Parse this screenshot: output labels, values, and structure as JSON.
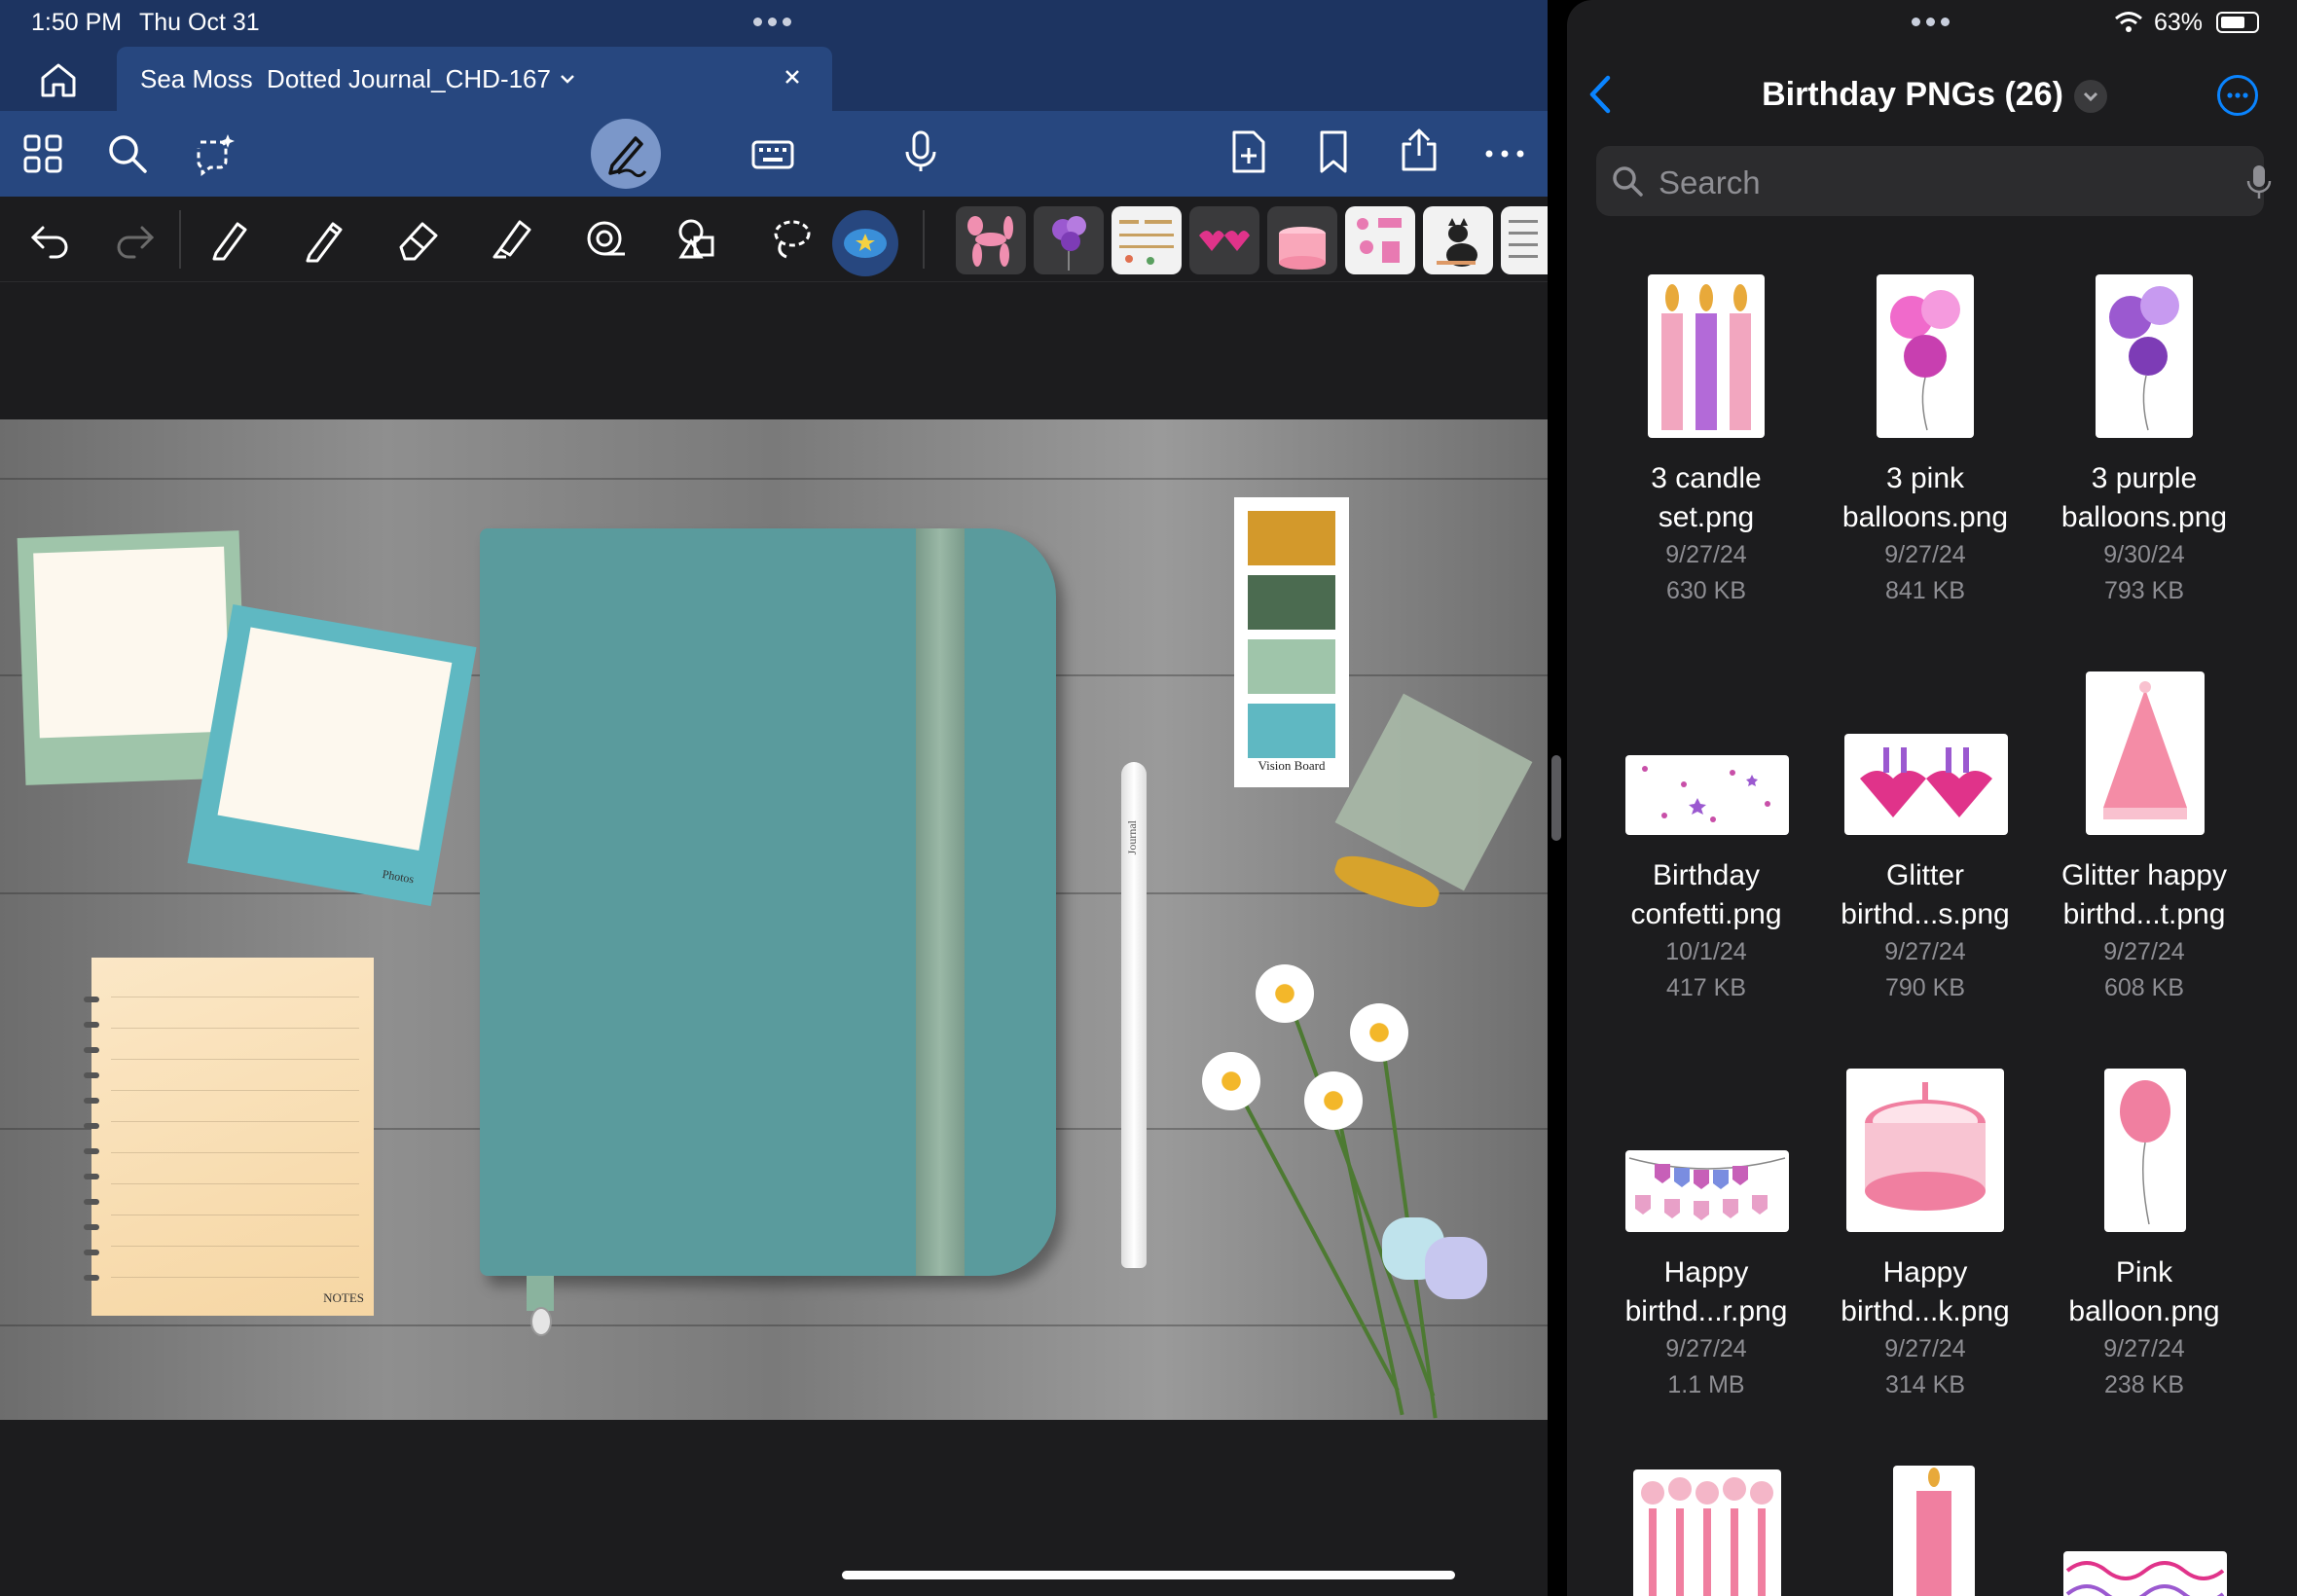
{
  "status": {
    "time": "1:50 PM",
    "date": "Thu Oct 31",
    "battery": "63%"
  },
  "document": {
    "tab_title": "Sea Moss  Dotted Journal_CHD-167"
  },
  "canvas_labels": {
    "photos": "Photos",
    "notes": "NOTES",
    "vision_board": "Vision Board",
    "pencil": "Journal"
  },
  "swatch_colors": [
    "#d3992b",
    "#4b6b50",
    "#9fc5aa",
    "#5fb8c2"
  ],
  "files_app": {
    "folder_title": "Birthday PNGs (26)",
    "search_placeholder": "Search",
    "files": [
      {
        "name_line1": "3 candle",
        "name_line2": "set.png",
        "date": "9/27/24",
        "size": "630 KB"
      },
      {
        "name_line1": "3 pink",
        "name_line2": "balloons.png",
        "date": "9/27/24",
        "size": "841 KB"
      },
      {
        "name_line1": "3 purple",
        "name_line2": "balloons.png",
        "date": "9/30/24",
        "size": "793 KB"
      },
      {
        "name_line1": "Birthday",
        "name_line2": "confetti.png",
        "date": "10/1/24",
        "size": "417 KB"
      },
      {
        "name_line1": "Glitter",
        "name_line2": "birthd...s.png",
        "date": "9/27/24",
        "size": "790 KB"
      },
      {
        "name_line1": "Glitter happy",
        "name_line2": "birthd...t.png",
        "date": "9/27/24",
        "size": "608 KB"
      },
      {
        "name_line1": "Happy",
        "name_line2": "birthd...r.png",
        "date": "9/27/24",
        "size": "1.1 MB"
      },
      {
        "name_line1": "Happy",
        "name_line2": "birthd...k.png",
        "date": "9/27/24",
        "size": "314 KB"
      },
      {
        "name_line1": "Pink",
        "name_line2": "balloon.png",
        "date": "9/27/24",
        "size": "238 KB"
      }
    ]
  },
  "colors": {
    "accent": "#0a84ff",
    "nav_blue": "#1d3461",
    "toolbar_blue": "#27477f"
  }
}
